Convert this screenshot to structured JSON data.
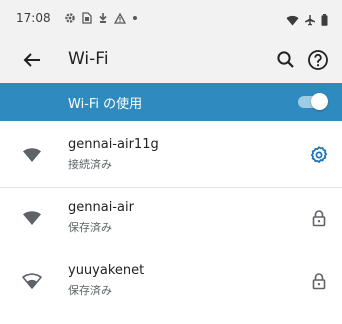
{
  "status_bar": {
    "time": "17:08",
    "notification_icons": [
      "settings-icon",
      "sim-icon",
      "download-icon",
      "alert-icon",
      "dot-icon"
    ],
    "right_icons": [
      "wifi-icon",
      "airplane-icon",
      "battery-icon"
    ]
  },
  "header": {
    "title": "Wi-Fi",
    "back_icon": "back-arrow-icon",
    "search_icon": "search-icon",
    "help_icon": "help-icon"
  },
  "wifi_master": {
    "label": "Wi-Fi の使用",
    "enabled": true,
    "background_color": "#2f8bbf"
  },
  "networks": [
    {
      "name": "gennai-air11g",
      "status": "接続済み",
      "signal": "full",
      "action_icon": "gear-icon"
    },
    {
      "name": "gennai-air",
      "status": "保存済み",
      "signal": "full",
      "action_icon": "lock-icon"
    },
    {
      "name": "yuuyakenet",
      "status": "保存済み",
      "signal": "partial",
      "action_icon": "lock-icon"
    }
  ],
  "colors": {
    "accent": "#1a73b8",
    "header_background": "#f2f2f2",
    "primary_text": "#202124",
    "secondary_text": "#5f6368"
  }
}
